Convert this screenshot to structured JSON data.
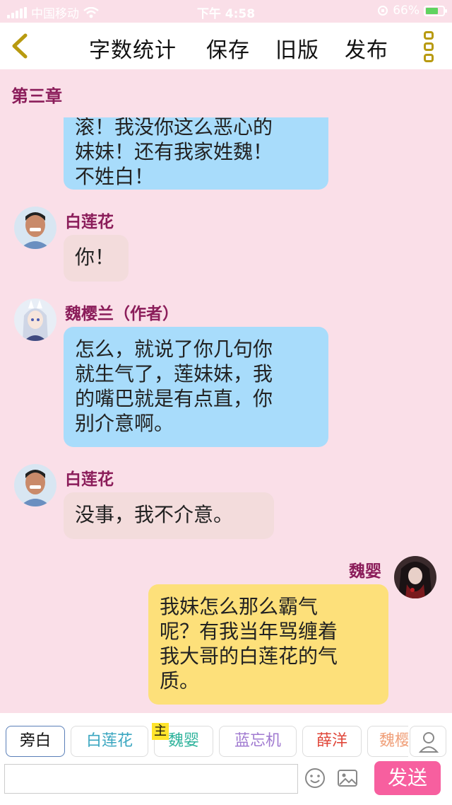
{
  "status_bar": {
    "carrier": "中国移动",
    "time": "下午 4:58",
    "battery": "66%",
    "battery_level": 0.66
  },
  "toolbar": {
    "back_icon": "chevron-left-icon",
    "word_count_label": "字数统计",
    "save_label": "保存",
    "old_version_label": "旧版",
    "publish_label": "发布",
    "menu_icon": "more-vertical-icon"
  },
  "chapter_title": "第三章",
  "messages": [
    {
      "speaker": "",
      "side": "left",
      "style": "blue",
      "lines": [
        "滚！我没你这么恶心的",
        "妹妹！还有我家姓魏！",
        "不姓白！"
      ]
    },
    {
      "speaker": "白莲花",
      "side": "left",
      "style": "pink",
      "lines": [
        "你！"
      ]
    },
    {
      "speaker": "魏樱兰（作者）",
      "side": "left",
      "style": "blue",
      "lines": [
        "怎么，就说了你几句你",
        "就生气了，莲妹妹，我",
        "的嘴巴就是有点直，你",
        "别介意啊。"
      ]
    },
    {
      "speaker": "白莲花",
      "side": "left",
      "style": "pink",
      "lines": [
        "没事，我不介意。"
      ]
    },
    {
      "speaker": "魏婴",
      "side": "right",
      "style": "yellow",
      "lines": [
        "我妹怎么那么霸气",
        "呢？有我当年骂缠着",
        "我大哥的白莲花的气",
        "质。"
      ]
    }
  ],
  "characters": [
    {
      "label": "旁白",
      "color": "#111111",
      "active": true
    },
    {
      "label": "白莲花",
      "color": "#3aa6c0",
      "active": false
    },
    {
      "label": "魏婴",
      "color": "#2fb39c",
      "active": false
    },
    {
      "label": "蓝忘机",
      "color": "#a07ad0",
      "active": false
    },
    {
      "label": "薛洋",
      "color": "#e0473a",
      "active": false
    },
    {
      "label": "魏樱",
      "color": "#f0a07a",
      "active": false
    }
  ],
  "main_tag": "主",
  "composer": {
    "placeholder": "",
    "emoji_icon": "smiley-icon",
    "image_icon": "image-icon",
    "profile_icon": "person-icon",
    "send_label": "发送"
  }
}
